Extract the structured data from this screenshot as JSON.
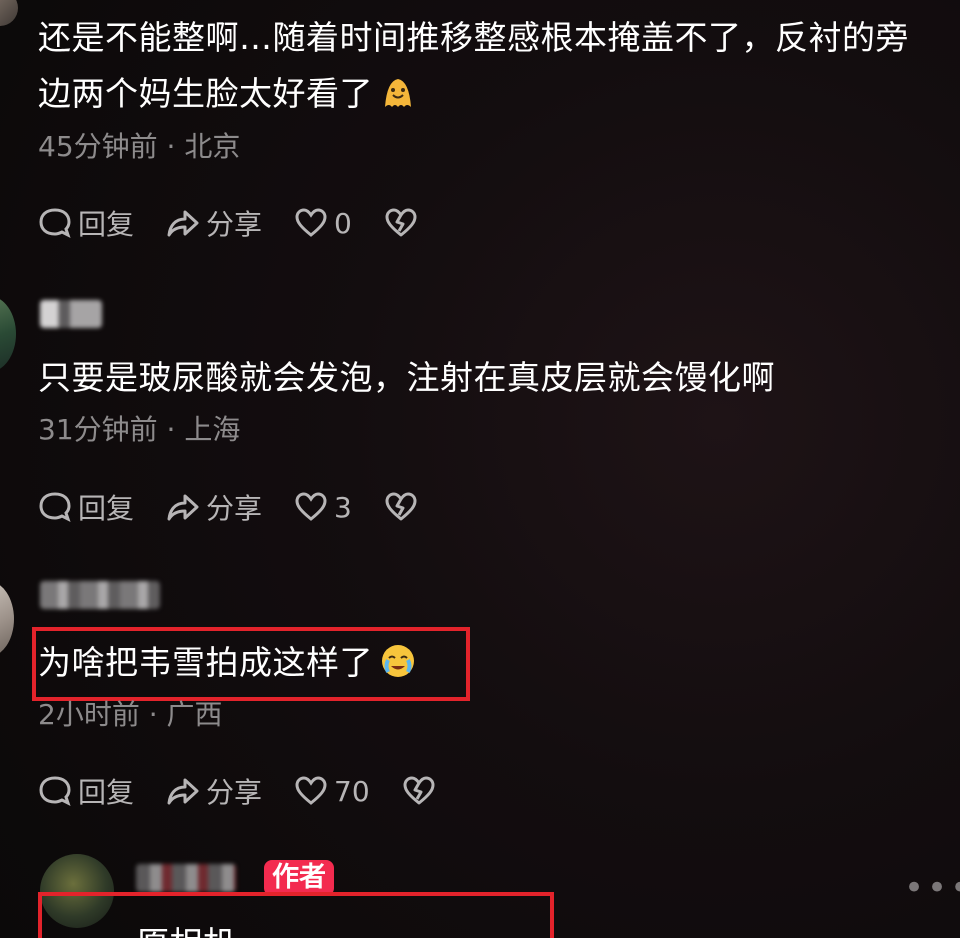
{
  "comments": [
    {
      "text_line1": "还是不能整啊…随着时间推移整感根本掩盖不了，反衬的旁",
      "text_line2": "边两个妈生脸太好看了",
      "meta": "45分钟前 · 北京",
      "reply_label": "回复",
      "share_label": "分享",
      "like_count": "0"
    },
    {
      "text": "只要是玻尿酸就会发泡，注射在真皮层就会馒化啊",
      "meta": "31分钟前 · 上海",
      "reply_label": "回复",
      "share_label": "分享",
      "like_count": "3"
    },
    {
      "text": "为啥把韦雪拍成这样了",
      "meta": "2小时前 · 广西",
      "reply_label": "回复",
      "share_label": "分享",
      "like_count": "70"
    },
    {
      "author_badge": "作者",
      "text": "原相机"
    }
  ],
  "colors": {
    "highlight": "#e3232b",
    "author_badge": "#f32b4f"
  },
  "icons": [
    "comment-bubble-icon",
    "share-arrow-icon",
    "heart-icon",
    "broken-heart-icon",
    "ellipsis-icon"
  ]
}
